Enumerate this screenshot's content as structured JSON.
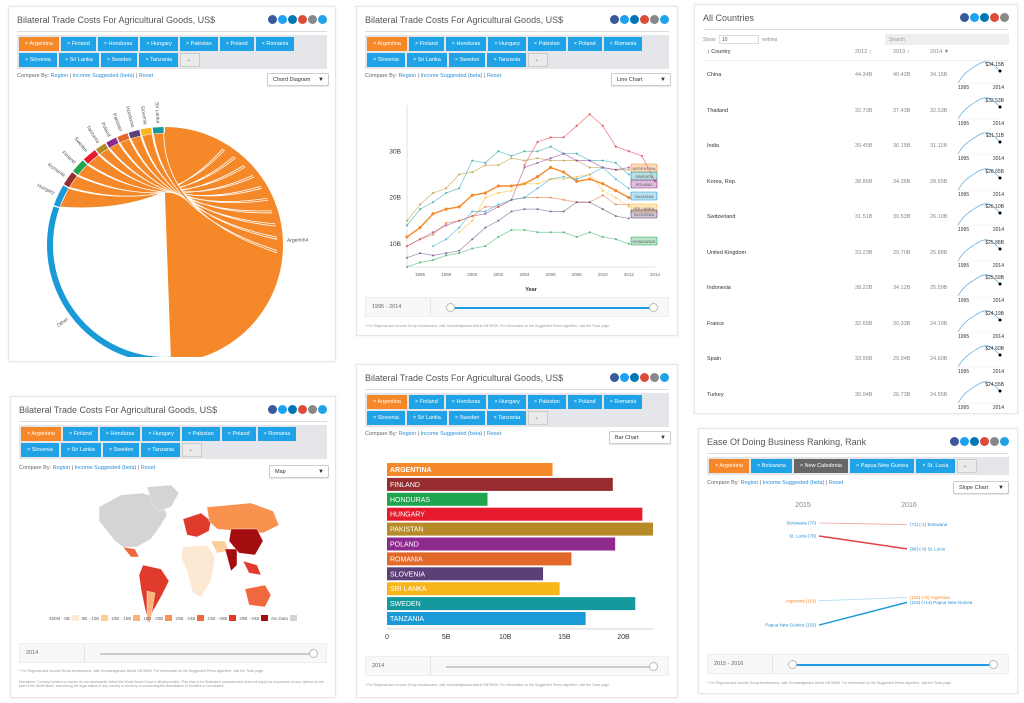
{
  "common": {
    "compare_label": "Compare By:",
    "region": "Region",
    "income": "Income",
    "suggested": "Suggested",
    "suggested_badge": "(beta)",
    "sep": "|",
    "reset": "Reset",
    "footnote": "* For Regional and Income Group breakdowns, visit: Knowledgebase Article KB78009. For information on the Suggested Peers algorithm, visit the Tools page.",
    "social_icons": [
      "facebook-icon",
      "twitter-icon",
      "linkedin-icon",
      "google-plus-icon",
      "email-icon",
      "share-icon"
    ],
    "social_colors": [
      "#3b5998",
      "#1da1f2",
      "#0077b5",
      "#dd4b39",
      "#888888",
      "#1fa3e6"
    ],
    "remove_glyph": "×",
    "add_glyph": "+"
  },
  "countries": [
    "Argentina",
    "Finland",
    "Honduras",
    "Hungary",
    "Pakistan",
    "Poland",
    "Romania",
    "Slovenia",
    "Sri Lanka",
    "Sweden",
    "Tanzania"
  ],
  "country_colors": {
    "Argentina": "#f5892a",
    "Finland": "#962b30",
    "Honduras": "#1ea54e",
    "Hungary": "#e51b2d",
    "Pakistan": "#b58a27",
    "Poland": "#8e2a8e",
    "Romania": "#e2682a",
    "Slovenia": "#5d3f78",
    "Sri Lanka": "#f8b51a",
    "Sweden": "#14999e",
    "Tanzania": "#1a9bd7"
  },
  "panels": {
    "chord": {
      "title": "Bilateral Trade Costs For Agricultural Goods, US$",
      "chart_type": "Chord Diagram"
    },
    "line": {
      "title": "Bilateral Trade Costs For Agricultural Goods, US$",
      "chart_type": "Line Chart",
      "slider_label": "1995 - 2014",
      "slider_range": [
        0,
        1
      ]
    },
    "map": {
      "title": "Bilateral Trade Costs For Agricultural Goods, US$",
      "chart_type": "Map",
      "slider_label": "2014",
      "slider_value": 1,
      "disclaimer": "Disclaimer: Country borders or names do not necessarily reflect the World Bank Group's official position. This map is for illustrative purposes and does not imply the expression of any opinion on the part of the World Bank, concerning the legal status of any country or territory or concerning the delimitation of frontiers or boundaries."
    },
    "bar": {
      "title": "Bilateral Trade Costs For Agricultural Goods, US$",
      "chart_type": "Bar Chart",
      "slider_label": "2014",
      "slider_value": 1
    },
    "table": {
      "title": "All Countries",
      "show_label": "Show",
      "show_value": "10",
      "entries_label": "entries",
      "search_placeholder": "Search",
      "columns": [
        "Country",
        "2012",
        "2013",
        "2014"
      ],
      "sort_marks": [
        "↕",
        "↕",
        "↕",
        "▼"
      ],
      "rows": [
        {
          "country": "China",
          "y2012": "44.34B",
          "y2013": "40.42B",
          "y2014": "34.15B",
          "spark_label": "$34.15B"
        },
        {
          "country": "Thailand",
          "y2012": "32.73B",
          "y2013": "37.43B",
          "y2014": "32.53B",
          "spark_label": "$32.53B"
        },
        {
          "country": "India",
          "y2012": "39.45B",
          "y2013": "36.15B",
          "y2014": "31.11B",
          "spark_label": "$31.11B"
        },
        {
          "country": "Korea, Rep.",
          "y2012": "38.86B",
          "y2013": "34.36B",
          "y2014": "28.65B",
          "spark_label": "$28.65B"
        },
        {
          "country": "Switzerland",
          "y2012": "31.51B",
          "y2013": "30.53B",
          "y2014": "26.10B",
          "spark_label": "$26.10B"
        },
        {
          "country": "United Kingdom",
          "y2012": "33.23B",
          "y2013": "29.70B",
          "y2014": "25.88B",
          "spark_label": "$25.88B"
        },
        {
          "country": "Indonesia",
          "y2012": "38.22B",
          "y2013": "34.12B",
          "y2014": "25.59B",
          "spark_label": "$25.59B"
        },
        {
          "country": "France",
          "y2012": "32.65B",
          "y2013": "30.33B",
          "y2014": "24.19B",
          "spark_label": "$24.19B"
        },
        {
          "country": "Spain",
          "y2012": "33.95B",
          "y2013": "29.94B",
          "y2014": "24.60B",
          "spark_label": "$24.60B"
        },
        {
          "country": "Turkey",
          "y2012": "30.94B",
          "y2013": "26.73B",
          "y2014": "24.55B",
          "spark_label": "$24.55B"
        }
      ],
      "spark_start": "1995",
      "spark_end": "2014"
    },
    "slope": {
      "title": "Ease Of Doing Business Ranking, Rank",
      "chart_type": "Slope Chart",
      "tags": [
        "Argentina",
        "Botswana",
        "New Caledonia",
        "Papua New Guinea",
        "St. Lucia"
      ],
      "slider_label": "2015 - 2016",
      "slider_range": [
        0,
        1
      ]
    }
  },
  "chart_data": [
    {
      "type": "chord",
      "title": "Bilateral Trade Costs For Agricultural Goods, US$",
      "groups": [
        "Argentina",
        "Other",
        "Hungary",
        "Romania",
        "Finland",
        "Sweden",
        "Tanzania",
        "Poland",
        "Pakistan",
        "Honduras",
        "Slovenia",
        "Sri Lanka"
      ],
      "group_share": [
        0.5,
        0.32,
        0.03,
        0.02,
        0.02,
        0.02,
        0.015,
        0.015,
        0.015,
        0.015,
        0.015,
        0.015
      ],
      "group_colors": [
        "#f5892a",
        "#1a9bd7",
        "#1a9bd7",
        "#962b30",
        "#1ea54e",
        "#e51b2d",
        "#b58a27",
        "#8e2a8e",
        "#e2682a",
        "#5d3f78",
        "#f8b51a",
        "#14999e"
      ]
    },
    {
      "type": "line",
      "title": "Bilateral Trade Costs For Agricultural Goods, US$",
      "xlabel": "Year",
      "ylabel": "",
      "x": [
        1995,
        1996,
        1997,
        1998,
        1999,
        2000,
        2001,
        2002,
        2003,
        2004,
        2005,
        2006,
        2007,
        2008,
        2009,
        2010,
        2011,
        2012,
        2013,
        2014
      ],
      "x_ticks": [
        "1996",
        "1998",
        "2000",
        "2002",
        "2004",
        "2006",
        "2008",
        "2010",
        "2012",
        "2014"
      ],
      "y_ticks": [
        "10B",
        "20B",
        "30B"
      ],
      "ylim": [
        5,
        40
      ],
      "series": [
        {
          "name": "Argentina",
          "values": [
            11.5,
            13.5,
            16.5,
            17.5,
            18,
            20.5,
            21,
            22.5,
            22.5,
            23,
            24.5,
            26.5,
            25.5,
            23.5,
            24,
            23,
            21.5,
            20,
            null,
            null
          ]
        },
        {
          "name": "Pakistan",
          "values": [
            15,
            18.5,
            21,
            22,
            25,
            25.5,
            27,
            27,
            28.5,
            28,
            28.5,
            28,
            28,
            28,
            26.5,
            26.5,
            26,
            26,
            null,
            null
          ]
        },
        {
          "name": "Sweden",
          "values": [
            14,
            17.5,
            19,
            21,
            22,
            28,
            27.5,
            30,
            29,
            30,
            30,
            31,
            29.5,
            29.5,
            28,
            28,
            27.5,
            25,
            null,
            null
          ]
        },
        {
          "name": "Hungary",
          "values": [
            null,
            null,
            null,
            null,
            null,
            null,
            null,
            null,
            null,
            27,
            32,
            33,
            33,
            35.5,
            38,
            35.5,
            31,
            30,
            29,
            23.5
          ]
        },
        {
          "name": "Poland",
          "values": [
            9.5,
            11,
            12.5,
            14,
            15,
            16,
            16.5,
            18,
            19.5,
            26.5,
            27.5,
            28.5,
            29.5,
            28,
            28,
            26.5,
            26,
            26.5,
            null,
            null
          ]
        },
        {
          "name": "Romania",
          "values": [
            9.5,
            11,
            12,
            14.5,
            15,
            16,
            18,
            18,
            19.5,
            20,
            20,
            20,
            19.5,
            19,
            19,
            20.5,
            18.5,
            18.5,
            null,
            null
          ]
        },
        {
          "name": "Tanzania",
          "values": [
            null,
            null,
            9.5,
            11,
            13.5,
            17,
            17,
            18.5,
            19.5,
            20,
            22,
            24,
            24.5,
            24,
            25,
            26.5,
            24,
            22,
            null,
            null
          ]
        },
        {
          "name": "Sri Lanka",
          "values": [
            null,
            null,
            null,
            null,
            12.5,
            15,
            20,
            21,
            21.5,
            23,
            23,
            24,
            24,
            24.5,
            25,
            21.5,
            20,
            18,
            null,
            null
          ]
        },
        {
          "name": "Slovenia",
          "values": [
            7,
            8,
            7.5,
            8,
            8.5,
            11,
            13.5,
            15,
            17,
            17.5,
            17.5,
            17,
            17,
            19,
            19,
            17.5,
            16,
            15.5,
            null,
            null
          ]
        },
        {
          "name": "Honduras",
          "values": [
            5,
            6,
            6.5,
            7.5,
            8,
            9,
            9.5,
            11.5,
            13,
            13,
            12.5,
            12.5,
            12.5,
            11.5,
            12.5,
            11.5,
            11,
            10,
            null,
            null
          ]
        }
      ],
      "end_labels": [
        "ARGENTINA",
        "SWEDEN",
        "POLAND",
        "TANZANIA",
        "SRI LANKA",
        "SLOVENIA",
        "HONDURAS"
      ]
    },
    {
      "type": "map",
      "title": "Bilateral Trade Costs For Agricultural Goods, US$",
      "legend": [
        {
          "label": "460M - 5B",
          "color": "#fde8d4"
        },
        {
          "label": "5B - 10B",
          "color": "#fdcd9a"
        },
        {
          "label": "10B - 15B",
          "color": "#fcb279"
        },
        {
          "label": "15B - 20B",
          "color": "#f8924e"
        },
        {
          "label": "20B - 24B",
          "color": "#f0683e"
        },
        {
          "label": "24B - 29B",
          "color": "#e03a2c"
        },
        {
          "label": "29B - 34B",
          "color": "#a30d10"
        },
        {
          "label": "No Data",
          "color": "#d4d4d4"
        }
      ]
    },
    {
      "type": "bar",
      "title": "Bilateral Trade Costs For Agricultural Goods, US$",
      "categories": [
        "ARGENTINA",
        "FINLAND",
        "HONDURAS",
        "HUNGARY",
        "PAKISTAN",
        "POLAND",
        "ROMANIA",
        "SLOVENIA",
        "SRI LANKA",
        "SWEDEN",
        "TANZANIA"
      ],
      "values": [
        14.0,
        19.1,
        8.5,
        21.6,
        22.5,
        19.3,
        15.6,
        13.2,
        14.6,
        21.0,
        16.8
      ],
      "x_ticks": [
        "0",
        "5B",
        "10B",
        "15B",
        "20B"
      ],
      "xlim": [
        0,
        22.5
      ]
    },
    {
      "type": "slope",
      "title": "Ease Of Doing Business Ranking, Rank",
      "years": [
        "2015",
        "2016"
      ],
      "series": [
        {
          "name": "Botswana",
          "start": 70,
          "end": 71,
          "left_label": "Botswana (70)",
          "right_label": "(71) (-1) Botswana",
          "color": "#f4a0a0"
        },
        {
          "name": "St. Lucia",
          "start": 78,
          "end": 86,
          "left_label": "St. Lucia (78)",
          "right_label": "(86) (-8) St. Lucia",
          "color": "#e8404a"
        },
        {
          "name": "Argentina",
          "start": 118,
          "end": 116,
          "left_label": "Argentina (118)",
          "right_label": "(116) (+2) Argentina",
          "color": "#a6d8f0"
        },
        {
          "name": "Papua New Guinea",
          "start": 133,
          "end": 119,
          "left_label": "Papua New Guinea (133)",
          "right_label": "(119) (+14) Papua New Guinea",
          "color": "#1a9bd7"
        }
      ]
    }
  ]
}
